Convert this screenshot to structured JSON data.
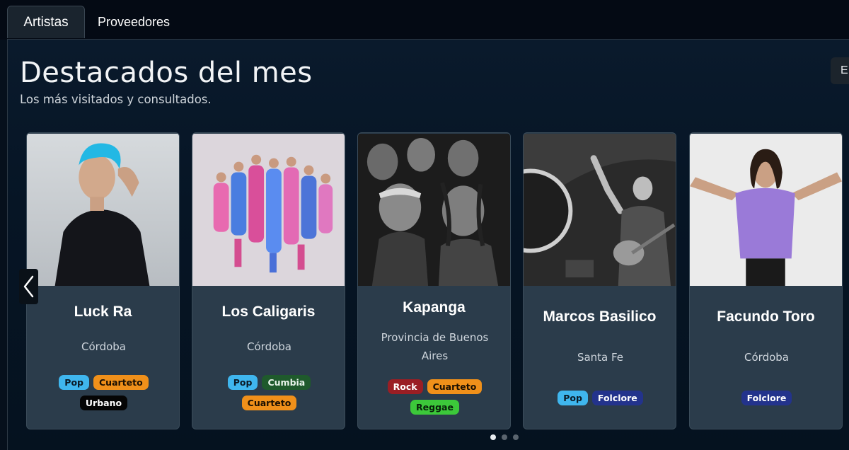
{
  "tabs": [
    {
      "label": "Artistas",
      "active": true
    },
    {
      "label": "Proveedores",
      "active": false
    }
  ],
  "section": {
    "title": "Destacados del mes",
    "subtitle": "Los más visitados y consultados.",
    "corner_button_label": "E"
  },
  "tag_colors": {
    "Pop": {
      "bg": "#3fb6ee",
      "fg": "#0b1a26"
    },
    "Cuarteto": {
      "bg": "#f0901a",
      "fg": "#1a0f02"
    },
    "Urbano": {
      "bg": "#050505",
      "fg": "#ffffff"
    },
    "Cumbia": {
      "bg": "#1f5a2c",
      "fg": "#e8f4ea"
    },
    "Rock": {
      "bg": "#9a1e24",
      "fg": "#ffffff"
    },
    "Reggae": {
      "bg": "#3cc83a",
      "fg": "#08200a"
    },
    "Folclore": {
      "bg": "#23338c",
      "fg": "#ffffff"
    }
  },
  "artists": [
    {
      "name": "Luck Ra",
      "location": "Córdoba",
      "tags": [
        "Pop",
        "Cuarteto",
        "Urbano"
      ],
      "photo": "portrait-blue-hair"
    },
    {
      "name": "Los Caligaris",
      "location": "Córdoba",
      "tags": [
        "Pop",
        "Cumbia",
        "Cuarteto"
      ],
      "photo": "group-colorful-costumes"
    },
    {
      "name": "Kapanga",
      "location": "Provincia de Buenos Aires",
      "tags": [
        "Rock",
        "Cuarteto",
        "Reggae"
      ],
      "photo": "band-black-white"
    },
    {
      "name": "Marcos Basilico",
      "location": "Santa Fe",
      "tags": [
        "Pop",
        "Folclore"
      ],
      "photo": "singer-guitar-stage"
    },
    {
      "name": "Facundo Toro",
      "location": "Córdoba",
      "tags": [
        "Folclore"
      ],
      "photo": "man-purple-shirt"
    }
  ],
  "carousel": {
    "pages": 3,
    "current": 1
  },
  "icons": {
    "prev": "chevron-left-icon"
  }
}
